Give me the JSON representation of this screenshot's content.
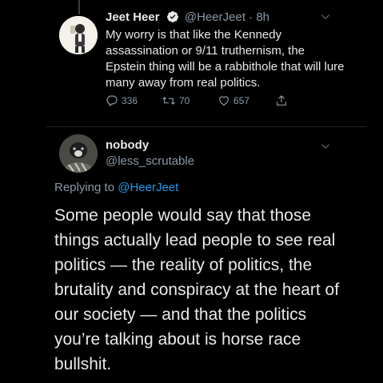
{
  "tweet1": {
    "name": "Jeet Heer",
    "handle": "@HeerJeet",
    "separator": "·",
    "time": "8h",
    "text": "My worry is that like the Kennedy assassination or 9/11 truthernism, the Epstein thing will be a rabbithole that will lure many away from real politics.",
    "replies": "336",
    "retweets": "70",
    "likes": "657"
  },
  "tweet2": {
    "name": "nobody",
    "handle": "@less_scrutable",
    "replying_prefix": "Replying to",
    "replying_to": "@HeerJeet",
    "text": "Some people would say that those things actually lead people to see real politics — the reality of politics, the brutality and conspiracy at the heart of our society — and that the politics you’re talking about is horse race bullshit."
  },
  "colors": {
    "background": "#000000",
    "text": "#e7e9ea",
    "secondary": "#8b98a5",
    "accent": "#1d9bf0"
  },
  "icons": [
    "verified-badge-icon",
    "reply-icon",
    "retweet-icon",
    "like-icon",
    "share-icon",
    "chevron-down-icon"
  ]
}
